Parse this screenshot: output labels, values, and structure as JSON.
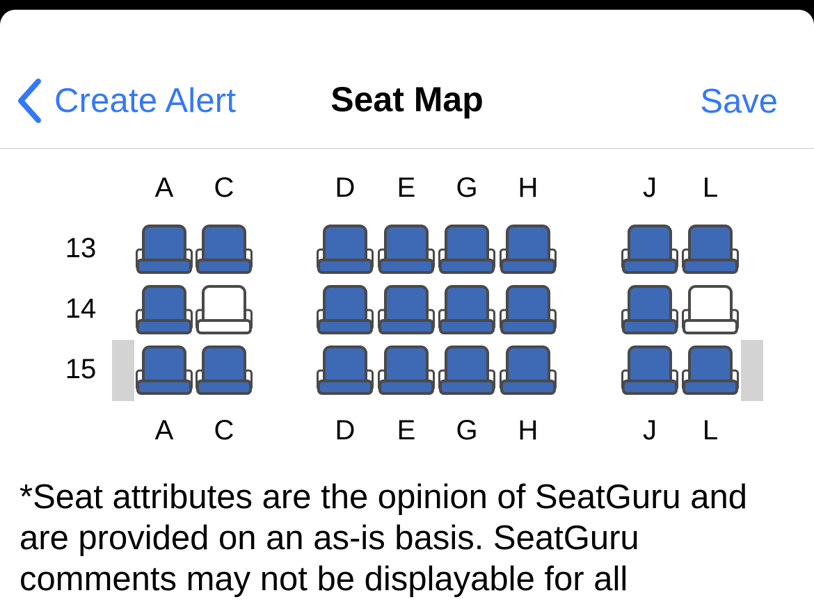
{
  "nav": {
    "back_label": "Create Alert",
    "title": "Seat Map",
    "save_label": "Save"
  },
  "seat_map": {
    "column_letters": [
      "A",
      "C",
      "D",
      "E",
      "G",
      "H",
      "J",
      "L"
    ],
    "rows": [
      {
        "number": "13",
        "exit_row": false,
        "seats": [
          {
            "col": "A",
            "status": "occupied"
          },
          {
            "col": "C",
            "status": "occupied"
          },
          {
            "col": "D",
            "status": "occupied"
          },
          {
            "col": "E",
            "status": "occupied"
          },
          {
            "col": "G",
            "status": "occupied"
          },
          {
            "col": "H",
            "status": "occupied"
          },
          {
            "col": "J",
            "status": "occupied"
          },
          {
            "col": "L",
            "status": "occupied"
          }
        ]
      },
      {
        "number": "14",
        "exit_row": false,
        "seats": [
          {
            "col": "A",
            "status": "occupied"
          },
          {
            "col": "C",
            "status": "available"
          },
          {
            "col": "D",
            "status": "occupied"
          },
          {
            "col": "E",
            "status": "occupied"
          },
          {
            "col": "G",
            "status": "occupied"
          },
          {
            "col": "H",
            "status": "occupied"
          },
          {
            "col": "J",
            "status": "occupied"
          },
          {
            "col": "L",
            "status": "available"
          }
        ]
      },
      {
        "number": "15",
        "exit_row": true,
        "seats": [
          {
            "col": "A",
            "status": "occupied"
          },
          {
            "col": "C",
            "status": "occupied"
          },
          {
            "col": "D",
            "status": "occupied"
          },
          {
            "col": "E",
            "status": "occupied"
          },
          {
            "col": "G",
            "status": "occupied"
          },
          {
            "col": "H",
            "status": "occupied"
          },
          {
            "col": "J",
            "status": "occupied"
          },
          {
            "col": "L",
            "status": "occupied"
          }
        ]
      }
    ]
  },
  "disclaimer": "*Seat attributes are the opinion of SeatGuru and are provided on an as-is basis. SeatGuru comments may not be displayable for all",
  "colors": {
    "accent": "#3478f6",
    "seat_occupied": "#3e69b4",
    "seat_outline": "#4a4a4a",
    "seat_available": "#ffffff",
    "exit_marker": "#d3d3d3"
  },
  "icons": {
    "back": "chevron-left-icon",
    "seat": "airline-seat-icon"
  }
}
